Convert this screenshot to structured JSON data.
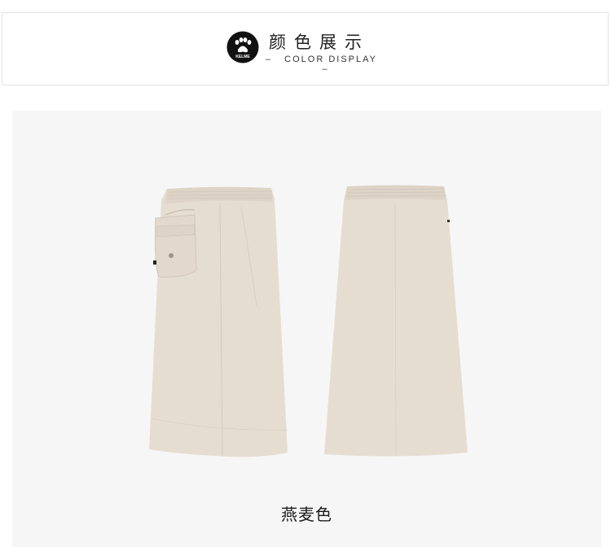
{
  "header": {
    "title_cn": "颜色展示",
    "title_en": "COLOR DISPLAY",
    "dash_left": "–",
    "dash_right": "–",
    "logo_text": "KELME"
  },
  "product": {
    "color_name": "燕麦色",
    "garment_color": "#e6ddd1",
    "views": [
      "front-skirt",
      "back-skirt"
    ]
  }
}
